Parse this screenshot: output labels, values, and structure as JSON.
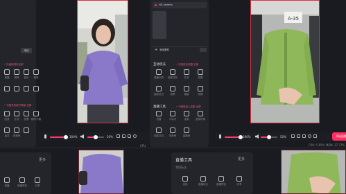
{
  "left_panel": {
    "button_label": "添加",
    "more_label": "更多",
    "section_label": "直播工具",
    "red_notes": [
      "• 扑面使用来全部",
      "• 今晚关闭部分场景 全部"
    ],
    "icons_row1": [
      "直播",
      "清晰",
      "音乐",
      "福袋"
    ],
    "icons_row2": [
      "",
      "",
      "",
      ""
    ],
    "icons_row3": [
      "回放",
      "互动",
      "投票",
      "超时开播"
    ],
    "icons_row4": [
      "抽奖",
      "语音房",
      "",
      "直播间"
    ]
  },
  "mid_panel": {
    "header_label": "HD camera",
    "add_material": "添加素材",
    "interact_title": "互动玩法",
    "interact_note": "• 礼物连击设置 全部",
    "interact_icons": [
      "直播礼物",
      "抽奖任务",
      "红包",
      "答题"
    ],
    "interact_icons2": [
      "抽奖红包",
      "投票",
      "福袋",
      "答题"
    ],
    "tools_title": "直播工具",
    "tools_note": "• 今晚新加入连麦 全部",
    "tool_icons": [
      "设置",
      "小玩法",
      "连麦",
      "虚拟形象"
    ],
    "tool_icons2": [
      "抽奖红包",
      "语音房",
      "直播间"
    ]
  },
  "player_bar_1": {
    "mic_level": 100,
    "mic_label": "100%",
    "speaker_level": 50,
    "speaker_label": "50%",
    "cpu": "CPU"
  },
  "player_bar_2": {
    "mic_level": 100,
    "mic_label": "100%",
    "speaker_level": 50,
    "speaker_label": "50%",
    "cpu_label": "CPU: 5.85%",
    "mem_label": "MEM: 37.37%",
    "start_button": "开始直播"
  },
  "bottom_panel": {
    "more_label": "更多",
    "tools_title": "直播工具",
    "tools_sub": "常用玩法",
    "tool_icons": [
      "连线",
      "直播玩法",
      "直播预告",
      "分享"
    ],
    "left_icons": [
      "直播",
      "直播预告",
      "分享"
    ]
  },
  "colors": {
    "accent": "#ff2e63",
    "panel": "#24252b",
    "bg": "#1a1b20",
    "frame": "#d9323f"
  }
}
